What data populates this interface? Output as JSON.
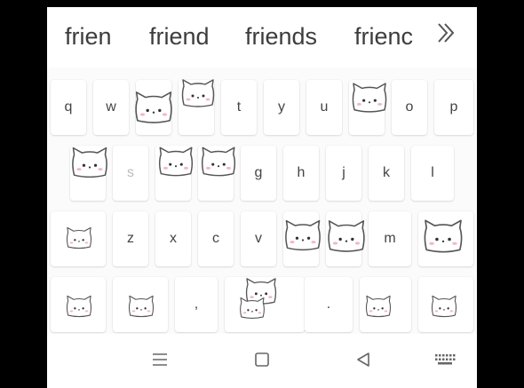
{
  "suggestions": {
    "s1": "frien",
    "s2": "friend",
    "s3": "friends",
    "s4": "frienc"
  },
  "keys": {
    "q": "q",
    "w": "w",
    "t": "t",
    "y": "y",
    "u": "u",
    "o": "o",
    "p": "p",
    "s": "s",
    "g": "g",
    "h": "h",
    "j": "j",
    "k": "k",
    "l": "l",
    "z": "z",
    "x": "x",
    "c": "c",
    "v": "v",
    "m": "m",
    "comma": ",",
    "period": "."
  },
  "icons": {
    "more": "chevron-double-right-icon",
    "sticker": "cat-face-icon",
    "nav_menu": "menu-icon",
    "nav_home": "square-home-icon",
    "nav_back": "triangle-back-icon",
    "nav_keyboard": "keyboard-icon"
  },
  "colors": {
    "key_text": "#444444",
    "key_bg": "#ffffff",
    "screen_bg": "#000000",
    "cat_outline": "#555555",
    "cat_blush": "#f3b8c2"
  }
}
